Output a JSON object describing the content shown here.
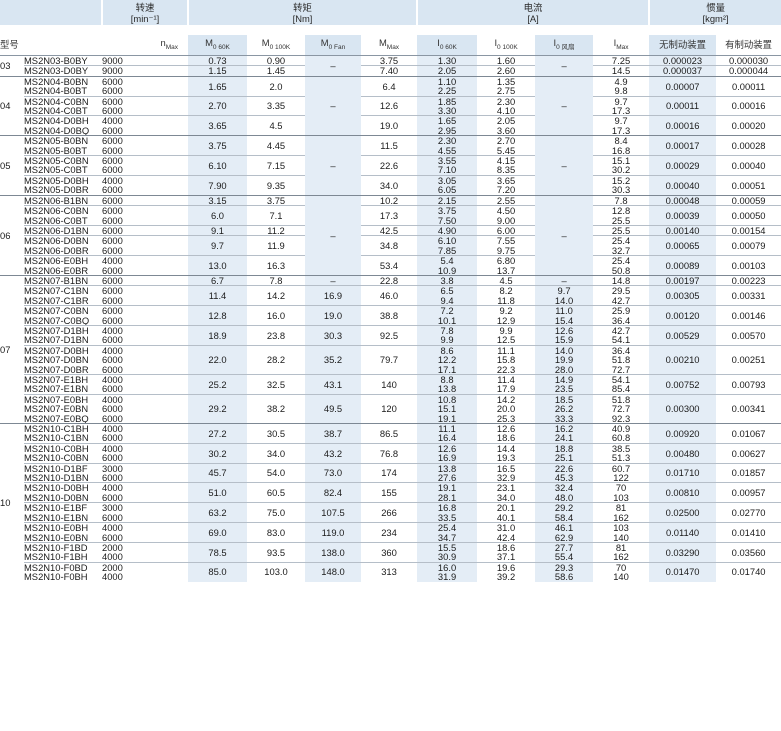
{
  "header": {
    "speed": {
      "title": "转速",
      "unit": "[min⁻¹]"
    },
    "torque": {
      "title": "转矩",
      "unit": "[Nm]"
    },
    "current": {
      "title": "电流",
      "unit": "[A]"
    },
    "inertia": {
      "title": "惯量",
      "unit": "[kgm²]"
    }
  },
  "columns": {
    "type": "型号",
    "nmax": {
      "main": "n",
      "sub": "Max"
    },
    "m0_60k": {
      "main": "M",
      "sub": "0 60K"
    },
    "m0_100k": {
      "main": "M",
      "sub": "0 100K"
    },
    "m0_fan": {
      "main": "M",
      "sub": "0 Fan"
    },
    "mmax": {
      "main": "M",
      "sub": "Max"
    },
    "i0_60k": {
      "main": "I",
      "sub": "0 60K"
    },
    "i0_100k": {
      "main": "I",
      "sub": "0 100K"
    },
    "i0_fan": {
      "main": "I",
      "sub": "0 风扇"
    },
    "imax": {
      "main": "I",
      "sub": "Max"
    },
    "no_brake": "无制动装置",
    "with_brake": "有制动装置"
  },
  "rows": [
    {
      "g": "03",
      "model": "MS2N03-B0BY",
      "n": "9000",
      "m60": "0.73",
      "m100": "0.90",
      "mfan": "–",
      "mmax": "3.75",
      "i60": "1.30",
      "i100": "1.60",
      "ifan": "–",
      "imax": "7.25",
      "nb": "0.000023",
      "wb": "0.000030"
    },
    {
      "model": "MS2N03-D0BY",
      "n": "9000",
      "m60": "1.15",
      "m100": "1.45",
      "mmax": "7.40",
      "i60": "2.05",
      "i100": "2.60",
      "imax": "14.5",
      "nb": "0.000037",
      "wb": "0.000044"
    },
    {
      "g": "04",
      "model": "MS2N04-B0BN",
      "n": "6000",
      "m60": "1.65",
      "m100": "2.0",
      "mfan": "–",
      "mmax": "6.4",
      "i60": "1.10",
      "i100": "1.35",
      "ifan": "–",
      "imax": "4.9",
      "nb": "0.00007",
      "wb": "0.00011"
    },
    {
      "model": "MS2N04-B0BT",
      "n": "6000",
      "i60": "2.25",
      "i100": "2.75",
      "imax": "9.8"
    },
    {
      "model": "MS2N04-C0BN",
      "n": "6000",
      "m60": "2.70",
      "m100": "3.35",
      "mmax": "12.6",
      "i60": "1.85",
      "i100": "2.30",
      "imax": "9.7",
      "nb": "0.00011",
      "wb": "0.00016"
    },
    {
      "model": "MS2N04-C0BT",
      "n": "6000",
      "i60": "3.30",
      "i100": "4.10",
      "imax": "17.3"
    },
    {
      "model": "MS2N04-D0BH",
      "n": "4000",
      "m60": "3.65",
      "m100": "4.5",
      "mmax": "19.0",
      "i60": "1.65",
      "i100": "2.05",
      "imax": "9.7",
      "nb": "0.00016",
      "wb": "0.00020"
    },
    {
      "model": "MS2N04-D0BQ",
      "n": "6000",
      "i60": "2.95",
      "i100": "3.60",
      "imax": "17.3"
    },
    {
      "g": "05",
      "model": "MS2N05-B0BN",
      "n": "6000",
      "m60": "3.75",
      "m100": "4.45",
      "mfan": "–",
      "mmax": "11.5",
      "i60": "2.30",
      "i100": "2.70",
      "ifan": "–",
      "imax": "8.4",
      "nb": "0.00017",
      "wb": "0.00028"
    },
    {
      "model": "MS2N05-B0BT",
      "n": "6000",
      "i60": "4.55",
      "i100": "5.45",
      "imax": "16.8"
    },
    {
      "model": "MS2N05-C0BN",
      "n": "6000",
      "m60": "6.10",
      "m100": "7.15",
      "mmax": "22.6",
      "i60": "3.55",
      "i100": "4.15",
      "imax": "15.1",
      "nb": "0.00029",
      "wb": "0.00040"
    },
    {
      "model": "MS2N05-C0BT",
      "n": "6000",
      "i60": "7.10",
      "i100": "8.35",
      "imax": "30.2"
    },
    {
      "model": "MS2N05-D0BH",
      "n": "4000",
      "m60": "7.90",
      "m100": "9.35",
      "mmax": "34.0",
      "i60": "3.05",
      "i100": "3.65",
      "imax": "15.2",
      "nb": "0.00040",
      "wb": "0.00051"
    },
    {
      "model": "MS2N05-D0BR",
      "n": "6000",
      "i60": "6.05",
      "i100": "7.20",
      "imax": "30.3"
    },
    {
      "g": "06",
      "model": "MS2N06-B1BN",
      "n": "6000",
      "m60": "3.15",
      "m100": "3.75",
      "mfan": "–",
      "mmax": "10.2",
      "i60": "2.15",
      "i100": "2.55",
      "ifan": "–",
      "imax": "7.8",
      "nb": "0.00048",
      "wb": "0.00059"
    },
    {
      "model": "MS2N06-C0BN",
      "n": "6000",
      "m60": "6.0",
      "m100": "7.1",
      "mmax": "17.3",
      "i60": "3.75",
      "i100": "4.50",
      "imax": "12.8",
      "nb": "0.00039",
      "wb": "0.00050"
    },
    {
      "model": "MS2N06-C0BT",
      "n": "6000",
      "i60": "7.50",
      "i100": "9.00",
      "imax": "25.5"
    },
    {
      "model": "MS2N06-D1BN",
      "n": "6000",
      "m60": "9.1",
      "m100": "11.2",
      "mmax": "42.5",
      "i60": "4.90",
      "i100": "6.00",
      "imax": "25.5",
      "nb": "0.00140",
      "wb": "0.00154"
    },
    {
      "model": "MS2N06-D0BN",
      "n": "6000",
      "m60": "9.7",
      "m100": "11.9",
      "mmax": "34.8",
      "i60": "6.10",
      "i100": "7.55",
      "imax": "25.4",
      "nb": "0.00065",
      "wb": "0.00079"
    },
    {
      "model": "MS2N06-D0BR",
      "n": "6000",
      "i60": "7.85",
      "i100": "9.75",
      "imax": "32.7"
    },
    {
      "model": "MS2N06-E0BH",
      "n": "4000",
      "m60": "13.0",
      "m100": "16.3",
      "mmax": "53.4",
      "i60": "5.4",
      "i100": "6.80",
      "imax": "25.4",
      "nb": "0.00089",
      "wb": "0.00103"
    },
    {
      "model": "MS2N06-E0BR",
      "n": "6000",
      "i60": "10.9",
      "i100": "13.7",
      "imax": "50.8"
    },
    {
      "g": "07",
      "model": "MS2N07-B1BN",
      "n": "6000",
      "m60": "6.7",
      "m100": "7.8",
      "mfan": "–",
      "mmax": "22.8",
      "i60": "3.8",
      "i100": "4.5",
      "ifan": "–",
      "imax": "14.8",
      "nb": "0.00197",
      "wb": "0.00223"
    },
    {
      "model": "MS2N07-C1BN",
      "n": "6000",
      "m60": "11.4",
      "m100": "14.2",
      "mfan": "16.9",
      "mmax": "46.0",
      "i60": "6.5",
      "i100": "8.2",
      "ifan": "9.7",
      "imax": "29.5",
      "nb": "0.00305",
      "wb": "0.00331"
    },
    {
      "model": "MS2N07-C1BR",
      "n": "6000",
      "i60": "9.4",
      "i100": "11.8",
      "ifan": "14.0",
      "imax": "42.7"
    },
    {
      "model": "MS2N07-C0BN",
      "n": "6000",
      "m60": "12.8",
      "m100": "16.0",
      "mfan": "19.0",
      "mmax": "38.8",
      "i60": "7.2",
      "i100": "9.2",
      "ifan": "11.0",
      "imax": "25.9",
      "nb": "0.00120",
      "wb": "0.00146"
    },
    {
      "model": "MS2N07-C0BQ",
      "n": "6000",
      "i60": "10.1",
      "i100": "12.9",
      "ifan": "15.4",
      "imax": "36.4"
    },
    {
      "model": "MS2N07-D1BH",
      "n": "4000",
      "m60": "18.9",
      "m100": "23.8",
      "mfan": "30.3",
      "mmax": "92.5",
      "i60": "7.8",
      "i100": "9.9",
      "ifan": "12.6",
      "imax": "42.7",
      "nb": "0.00529",
      "wb": "0.00570"
    },
    {
      "model": "MS2N07-D1BN",
      "n": "6000",
      "i60": "9.9",
      "i100": "12.5",
      "ifan": "15.9",
      "imax": "54.1"
    },
    {
      "model": "MS2N07-D0BH",
      "n": "4000",
      "m60": "22.0",
      "m100": "28.2",
      "mfan": "35.2",
      "mmax": "79.7",
      "i60": "8.6",
      "i100": "11.1",
      "ifan": "14.0",
      "imax": "36.4",
      "nb": "0.00210",
      "wb": "0.00251"
    },
    {
      "model": "MS2N07-D0BN",
      "n": "6000",
      "i60": "12.2",
      "i100": "15.8",
      "ifan": "19.9",
      "imax": "51.8"
    },
    {
      "model": "MS2N07-D0BR",
      "n": "6000",
      "i60": "17.1",
      "i100": "22.3",
      "ifan": "28.0",
      "imax": "72.7"
    },
    {
      "model": "MS2N07-E1BH",
      "n": "4000",
      "m60": "25.2",
      "m100": "32.5",
      "mfan": "43.1",
      "mmax": "140",
      "i60": "8.8",
      "i100": "11.4",
      "ifan": "14.9",
      "imax": "54.1",
      "nb": "0.00752",
      "wb": "0.00793"
    },
    {
      "model": "MS2N07-E1BN",
      "n": "6000",
      "i60": "13.8",
      "i100": "17.9",
      "ifan": "23.5",
      "imax": "85.4"
    },
    {
      "model": "MS2N07-E0BH",
      "n": "4000",
      "m60": "29.2",
      "m100": "38.2",
      "mfan": "49.5",
      "mmax": "120",
      "i60": "10.8",
      "i100": "14.2",
      "ifan": "18.5",
      "imax": "51.8",
      "nb": "0.00300",
      "wb": "0.00341"
    },
    {
      "model": "MS2N07-E0BN",
      "n": "6000",
      "i60": "15.1",
      "i100": "20.0",
      "ifan": "26.2",
      "imax": "72.7"
    },
    {
      "model": "MS2N07-E0BQ",
      "n": "6000",
      "i60": "19.1",
      "i100": "25.3",
      "ifan": "33.3",
      "imax": "92.3"
    },
    {
      "g": "10",
      "model": "MS2N10-C1BH",
      "n": "4000",
      "m60": "27.2",
      "m100": "30.5",
      "mfan": "38.7",
      "mmax": "86.5",
      "i60": "11.1",
      "i100": "12.6",
      "ifan": "16.2",
      "imax": "40.9",
      "nb": "0.00920",
      "wb": "0.01067"
    },
    {
      "model": "MS2N10-C1BN",
      "n": "6000",
      "i60": "16.4",
      "i100": "18.6",
      "ifan": "24.1",
      "imax": "60.8"
    },
    {
      "model": "MS2N10-C0BH",
      "n": "4000",
      "m60": "30.2",
      "m100": "34.0",
      "mfan": "43.2",
      "mmax": "76.8",
      "i60": "12.6",
      "i100": "14.4",
      "ifan": "18.8",
      "imax": "38.5",
      "nb": "0.00480",
      "wb": "0.00627"
    },
    {
      "model": "MS2N10-C0BN",
      "n": "6000",
      "i60": "16.9",
      "i100": "19.3",
      "ifan": "25.1",
      "imax": "51.3"
    },
    {
      "model": "MS2N10-D1BF",
      "n": "3000",
      "m60": "45.7",
      "m100": "54.0",
      "mfan": "73.0",
      "mmax": "174",
      "i60": "13.8",
      "i100": "16.5",
      "ifan": "22.6",
      "imax": "60.7",
      "nb": "0.01710",
      "wb": "0.01857"
    },
    {
      "model": "MS2N10-D1BN",
      "n": "6000",
      "i60": "27.6",
      "i100": "32.9",
      "ifan": "45.3",
      "imax": "122"
    },
    {
      "model": "MS2N10-D0BH",
      "n": "4000",
      "m60": "51.0",
      "m100": "60.5",
      "mfan": "82.4",
      "mmax": "155",
      "i60": "19.1",
      "i100": "23.1",
      "ifan": "32.4",
      "imax": "70",
      "nb": "0.00810",
      "wb": "0.00957"
    },
    {
      "model": "MS2N10-D0BN",
      "n": "6000",
      "i60": "28.1",
      "i100": "34.0",
      "ifan": "48.0",
      "imax": "103"
    },
    {
      "model": "MS2N10-E1BF",
      "n": "3000",
      "m60": "63.2",
      "m100": "75.0",
      "mfan": "107.5",
      "mmax": "266",
      "i60": "16.8",
      "i100": "20.1",
      "ifan": "29.2",
      "imax": "81",
      "nb": "0.02500",
      "wb": "0.02770"
    },
    {
      "model": "MS2N10-E1BN",
      "n": "6000",
      "i60": "33.5",
      "i100": "40.1",
      "ifan": "58.4",
      "imax": "162"
    },
    {
      "model": "MS2N10-E0BH",
      "n": "4000",
      "m60": "69.0",
      "m100": "83.0",
      "mfan": "119.0",
      "mmax": "234",
      "i60": "25.4",
      "i100": "31.0",
      "ifan": "46.1",
      "imax": "103",
      "nb": "0.01140",
      "wb": "0.01410"
    },
    {
      "model": "MS2N10-E0BN",
      "n": "6000",
      "i60": "34.7",
      "i100": "42.4",
      "ifan": "62.9",
      "imax": "140"
    },
    {
      "model": "MS2N10-F1BD",
      "n": "2000",
      "m60": "78.5",
      "m100": "93.5",
      "mfan": "138.0",
      "mmax": "360",
      "i60": "15.5",
      "i100": "18.6",
      "ifan": "27.7",
      "imax": "81",
      "nb": "0.03290",
      "wb": "0.03560"
    },
    {
      "model": "MS2N10-F1BH",
      "n": "4000",
      "i60": "30.9",
      "i100": "37.1",
      "ifan": "55.4",
      "imax": "162"
    },
    {
      "model": "MS2N10-F0BD",
      "n": "2000",
      "m60": "85.0",
      "m100": "103.0",
      "mfan": "148.0",
      "mmax": "313",
      "i60": "16.0",
      "i100": "19.6",
      "ifan": "29.3",
      "imax": "70",
      "nb": "0.01470",
      "wb": "0.01740"
    },
    {
      "model": "MS2N10-F0BH",
      "n": "4000",
      "i60": "31.9",
      "i100": "39.2",
      "ifan": "58.6",
      "imax": "140"
    }
  ]
}
